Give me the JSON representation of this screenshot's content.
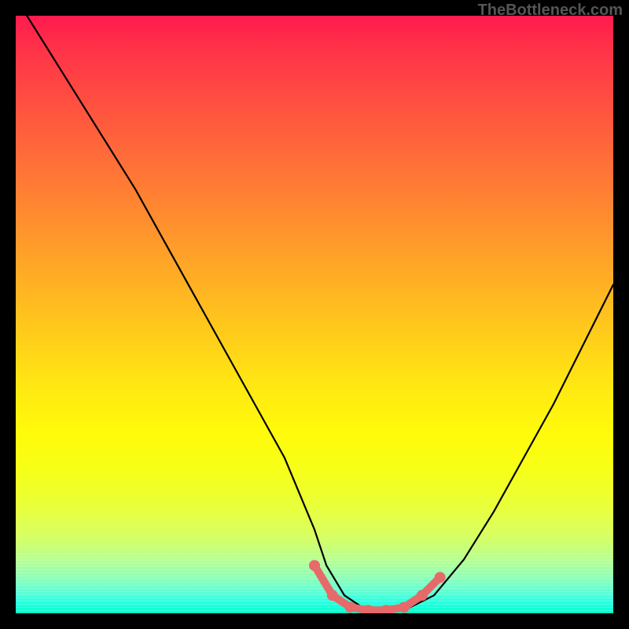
{
  "watermark": "TheBottleneck.com",
  "chart_data": {
    "type": "line",
    "title": "",
    "xlabel": "",
    "ylabel": "",
    "xlim": [
      0,
      100
    ],
    "ylim": [
      0,
      100
    ],
    "grid": false,
    "series": [
      {
        "name": "bottleneck-curve",
        "x": [
          0,
          5,
          10,
          15,
          20,
          25,
          30,
          35,
          40,
          45,
          50,
          52,
          55,
          58,
          60,
          63,
          66,
          70,
          75,
          80,
          85,
          90,
          95,
          100
        ],
        "y": [
          103,
          95,
          87,
          79,
          71,
          62,
          53,
          44,
          35,
          26,
          14,
          8,
          3,
          1,
          0.5,
          0.5,
          1,
          3,
          9,
          17,
          26,
          35,
          45,
          55
        ]
      }
    ],
    "markers": {
      "name": "highlighted-range",
      "color": "#e66a6a",
      "x": [
        50,
        53,
        56,
        59,
        62,
        65,
        68,
        71
      ],
      "y": [
        8,
        3,
        1,
        0.5,
        0.5,
        1,
        3,
        6
      ]
    }
  }
}
